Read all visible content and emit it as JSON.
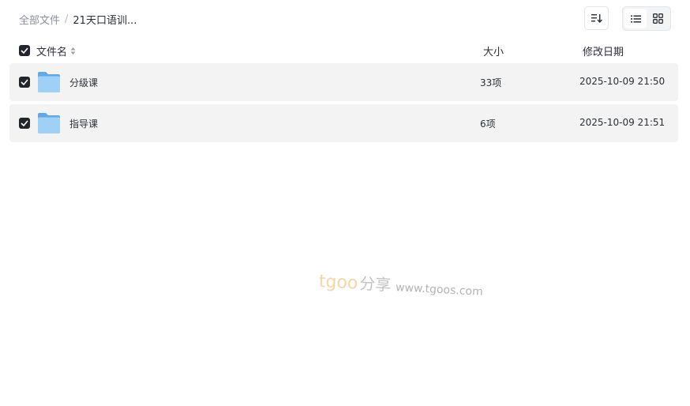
{
  "breadcrumb": {
    "root": "全部文件",
    "separator": "/",
    "current": "21天口语训..."
  },
  "toolbar": {
    "sort_icon": "sort-descending-icon",
    "view_list_icon": "list-view-icon",
    "view_grid_icon": "grid-view-icon",
    "active_view": "list"
  },
  "table": {
    "columns": {
      "name": "文件名",
      "size": "大小",
      "date": "修改日期"
    },
    "rows": [
      {
        "name": "分级课",
        "size": "33项",
        "date": "2025-10-09 21:50",
        "checked": true,
        "icon": "folder-icon"
      },
      {
        "name": "指导课",
        "size": "6项",
        "date": "2025-10-09 21:51",
        "checked": true,
        "icon": "folder-icon"
      }
    ]
  },
  "watermark": {
    "brand": "tgoo",
    "cn": "分享",
    "url": "www.tgoos.com"
  },
  "colors": {
    "row_bg": "#f3f3f3",
    "checkbox": "#22252b",
    "folder_light": "#9fd0f5",
    "folder_dark": "#5fa8ea"
  }
}
